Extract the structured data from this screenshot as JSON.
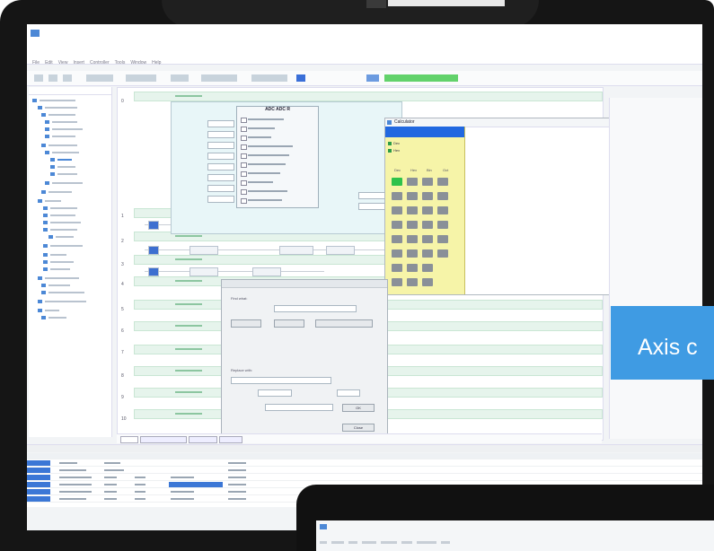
{
  "app": {
    "title": "",
    "menu": [
      "File",
      "Edit",
      "View",
      "Insert",
      "Controller",
      "Tools",
      "Window",
      "Help"
    ]
  },
  "editor": {
    "rungs": [
      "0",
      "1",
      "2",
      "3",
      "4",
      "5",
      "6",
      "7",
      "8",
      "9",
      "10"
    ],
    "instruction_title": "ADC ADC R"
  },
  "calculator": {
    "title": "Calculator",
    "options": [
      "Dec",
      "Hex",
      "Bin",
      "Oct"
    ],
    "key_labels": [
      "A",
      "B",
      "C",
      "D",
      "E",
      "F",
      "7",
      "8",
      "9",
      "4",
      "5",
      "6",
      "1",
      "2",
      "3",
      "0"
    ]
  },
  "find_dialog": {
    "find_label": "Find what:",
    "replace_label": "Replace with:",
    "ok": "OK",
    "cancel": "Close"
  },
  "banner": {
    "text": "Axis c"
  },
  "colors": {
    "banner_blue": "#3f9be3",
    "calc_panel": "#f6f4a8",
    "calc_header": "#2268e0",
    "key_green": "#2ec24b",
    "rung_green": "#e6f4ec",
    "toolbar_green": "#62d26b"
  }
}
